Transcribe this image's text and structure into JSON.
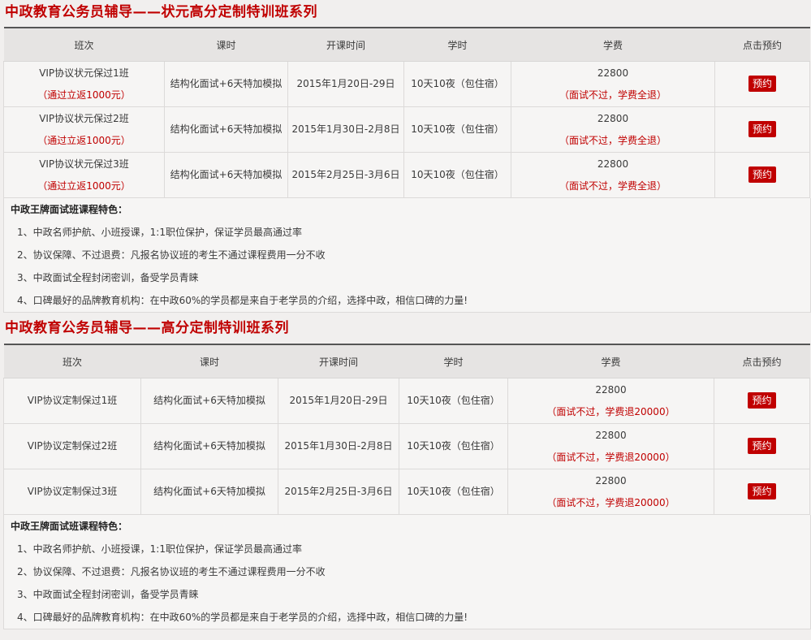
{
  "sections": [
    {
      "title": "中政教育公务员辅导——状元高分定制特训班系列",
      "headers": [
        "班次",
        "课时",
        "开课时间",
        "学时",
        "学费",
        "点击预约"
      ],
      "rows": [
        {
          "name": "VIP协议状元保过1班",
          "note": "（通过立返1000元）",
          "course": "结构化面试+6天特加模拟",
          "date": "2015年1月20日-29日",
          "hours": "10天10夜（包住宿）",
          "fee": "22800",
          "fee_note": "（面试不过，学费全退）",
          "book": "预约"
        },
        {
          "name": "VIP协议状元保过2班",
          "note": "（通过立返1000元）",
          "course": "结构化面试+6天特加模拟",
          "date": "2015年1月30日-2月8日",
          "hours": "10天10夜（包住宿）",
          "fee": "22800",
          "fee_note": "（面试不过，学费全退）",
          "book": "预约"
        },
        {
          "name": "VIP协议状元保过3班",
          "note": "（通过立返1000元）",
          "course": "结构化面试+6天特加模拟",
          "date": "2015年2月25日-3月6日",
          "hours": "10天10夜（包住宿）",
          "fee": "22800",
          "fee_note": "（面试不过，学费全退）",
          "book": "预约"
        }
      ],
      "features_title": "中政王牌面试班课程特色：",
      "features": [
        "1、中政名师护航、小班授课，1:1职位保护，保证学员最高通过率",
        "2、协议保障、不过退费：凡报名协议班的考生不通过课程费用一分不收",
        "3、中政面试全程封闭密训，备受学员青睐",
        "4、口碑最好的品牌教育机构：在中政60%的学员都是来自于老学员的介绍，选择中政，相信口碑的力量!"
      ]
    },
    {
      "title": "中政教育公务员辅导——高分定制特训班系列",
      "headers": [
        "班次",
        "课时",
        "开课时间",
        "学时",
        "学费",
        "点击预约"
      ],
      "rows": [
        {
          "name": "VIP协议定制保过1班",
          "course": "结构化面试+6天特加模拟",
          "date": "2015年1月20日-29日",
          "hours": "10天10夜（包住宿）",
          "fee": "22800",
          "fee_note": "（面试不过，学费退20000）",
          "book": "预约"
        },
        {
          "name": "VIP协议定制保过2班",
          "course": "结构化面试+6天特加模拟",
          "date": "2015年1月30日-2月8日",
          "hours": "10天10夜（包住宿）",
          "fee": "22800",
          "fee_note": "（面试不过，学费退20000）",
          "book": "预约"
        },
        {
          "name": "VIP协议定制保过3班",
          "course": "结构化面试+6天特加模拟",
          "date": "2015年2月25日-3月6日",
          "hours": "10天10夜（包住宿）",
          "fee": "22800",
          "fee_note": "（面试不过，学费退20000）",
          "book": "预约"
        }
      ],
      "features_title": "中政王牌面试班课程特色：",
      "features": [
        "1、中政名师护航、小班授课，1:1职位保护，保证学员最高通过率",
        "2、协议保障、不过退费：凡报名协议班的考生不通过课程费用一分不收",
        "3、中政面试全程封闭密训，备受学员青睐",
        "4、口碑最好的品牌教育机构：在中政60%的学员都是来自于老学员的介绍，选择中政，相信口碑的力量!"
      ]
    }
  ],
  "colors": {
    "accent": "#c00000",
    "header_bg": "#e6e4e3",
    "cell_bg": "#f6f5f4",
    "page_bg": "#f1efee"
  }
}
